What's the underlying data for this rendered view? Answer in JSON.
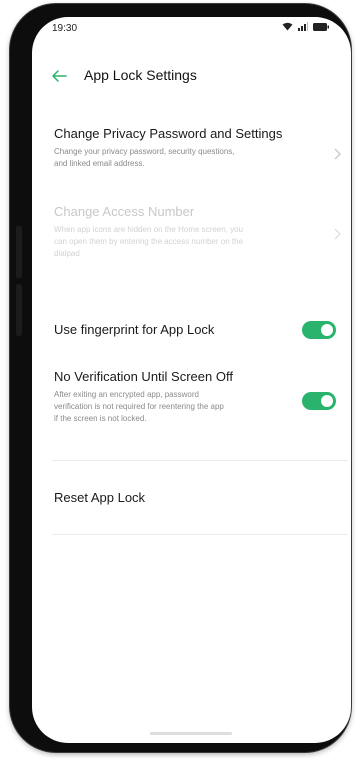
{
  "status_bar": {
    "time": "19:30",
    "icons": [
      "wifi-icon",
      "signal-icon",
      "battery-icon"
    ]
  },
  "header": {
    "title": "App Lock Settings",
    "back_icon": "arrow-left-icon"
  },
  "settings": {
    "privacy": {
      "title": "Change Privacy Password and Settings",
      "description_line1": "Change your privacy password, security questions,",
      "description_line2": "and linked email address."
    },
    "access_number": {
      "title": "Change Access Number",
      "description_line1": "When app icons are hidden on the Home screen, you",
      "description_line2": "can open them by entering the access number on the",
      "description_line3": "dialpad"
    },
    "fingerprint": {
      "title": "Use fingerprint for App Lock",
      "enabled": true
    },
    "no_verification": {
      "title": "No Verification Until Screen Off",
      "description_line1": "After exiting an encrypted app, password",
      "description_line2": "verification is not required for reentering the app",
      "description_line3": "if the screen is not locked.",
      "enabled": true
    },
    "reset": {
      "title": "Reset App Lock"
    }
  },
  "colors": {
    "accent": "#2ab36c",
    "back_arrow": "#2ab36c",
    "disabled_text": "#c8c8c8"
  }
}
